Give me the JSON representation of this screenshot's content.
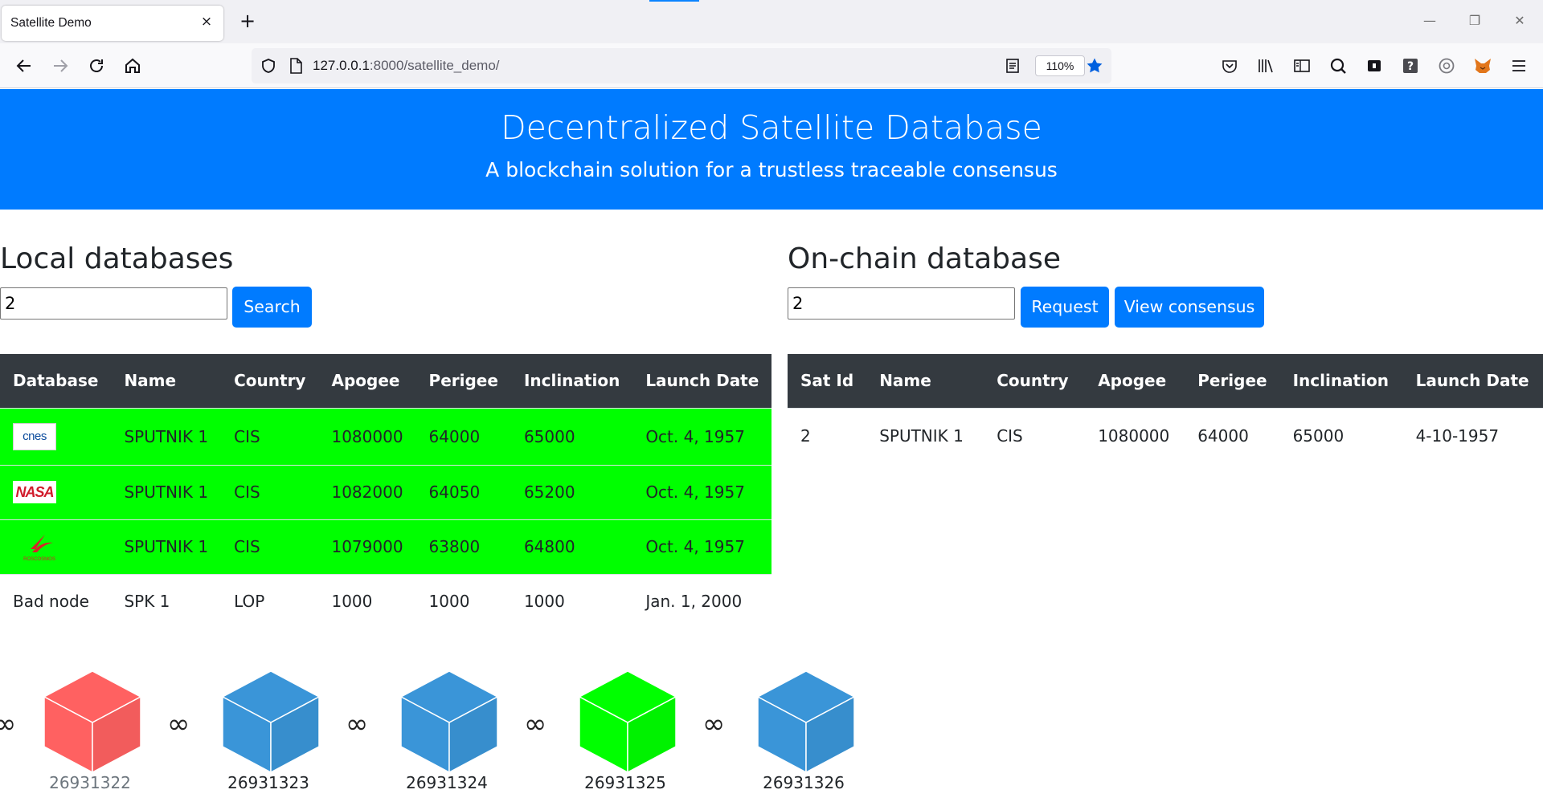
{
  "browser": {
    "tab_title": "Satellite Demo",
    "tab_close": "×",
    "new_tab": "+",
    "url_host": "127.0.0.1",
    "url_rest": ":8000/satellite_demo/",
    "zoom": "110%",
    "window_controls": [
      "—",
      "❐",
      "✕"
    ]
  },
  "header": {
    "title": "Decentralized Satellite Database",
    "subtitle": "A blockchain solution for a trustless traceable consensus"
  },
  "local": {
    "title": "Local databases",
    "input_value": "2",
    "search_label": "Search",
    "columns": [
      "Database",
      "Name",
      "Country",
      "Apogee",
      "Perigee",
      "Inclination",
      "Launch Date"
    ],
    "rows": [
      {
        "database": "cnes",
        "name": "SPUTNIK 1",
        "country": "CIS",
        "apogee": "1080000",
        "perigee": "64000",
        "inclination": "65000",
        "launch": "Oct. 4, 1957"
      },
      {
        "database": "NASA",
        "name": "SPUTNIK 1",
        "country": "CIS",
        "apogee": "1082000",
        "perigee": "64050",
        "inclination": "65200",
        "launch": "Oct. 4, 1957"
      },
      {
        "database": "ROSCOSMOS",
        "name": "SPUTNIK 1",
        "country": "CIS",
        "apogee": "1079000",
        "perigee": "63800",
        "inclination": "64800",
        "launch": "Oct. 4, 1957"
      },
      {
        "database": "Bad node",
        "name": "SPK 1",
        "country": "LOP",
        "apogee": "1000",
        "perigee": "1000",
        "inclination": "1000",
        "launch": "Jan. 1, 2000"
      }
    ]
  },
  "onchain": {
    "title": "On-chain database",
    "input_value": "2",
    "request_label": "Request",
    "consensus_label": "View consensus",
    "columns": [
      "Sat Id",
      "Name",
      "Country",
      "Apogee",
      "Perigee",
      "Inclination",
      "Launch Date"
    ],
    "rows": [
      {
        "sat_id": "2",
        "name": "SPUTNIK 1",
        "country": "CIS",
        "apogee": "1080000",
        "perigee": "64000",
        "inclination": "65000",
        "launch": "4-10-1957"
      }
    ]
  },
  "chain": {
    "blocks": [
      {
        "id": "26931322",
        "color": "#ff6161"
      },
      {
        "id": "26931323",
        "color": "#3a95d8"
      },
      {
        "id": "26931324",
        "color": "#3a95d8"
      },
      {
        "id": "26931325",
        "color": "#00ff00"
      },
      {
        "id": "26931326",
        "color": "#3a95d8"
      }
    ],
    "link_glyph": "∞"
  },
  "colors": {
    "primary": "#007bff",
    "table_header": "#343a40",
    "row_match": "#00ff00",
    "bad_node": "#dc1c1c"
  }
}
